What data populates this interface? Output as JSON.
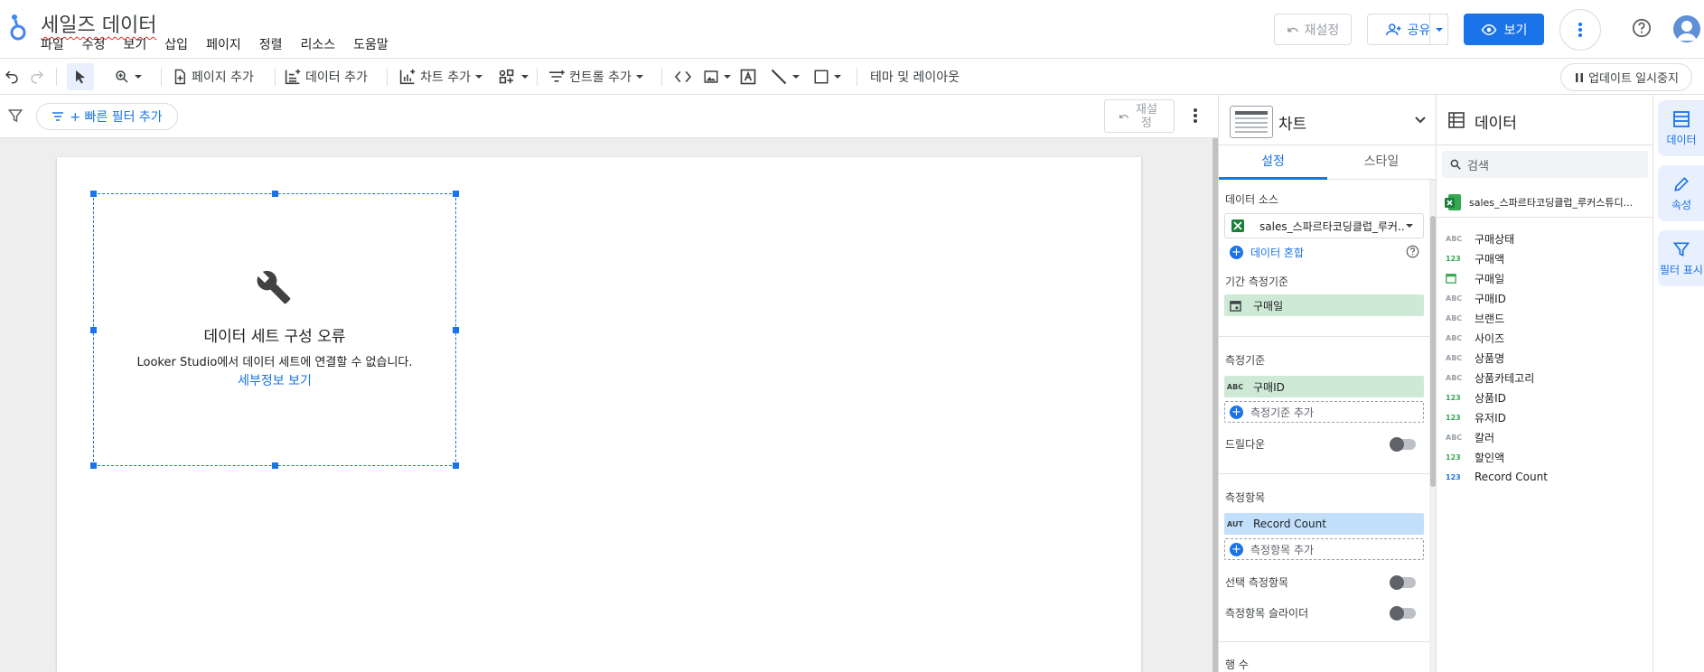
{
  "app": {
    "doc_title": "세일즈 데이터",
    "menu": [
      "파일",
      "수정",
      "보기",
      "삽입",
      "페이지",
      "정렬",
      "리소스",
      "도움말"
    ],
    "reset_label": "재설정",
    "share_label": "공유",
    "view_label": "보기"
  },
  "toolbar": {
    "add_page": "페이지 추가",
    "add_data": "데이터 추가",
    "add_chart": "차트 추가",
    "add_control": "컨트롤 추가",
    "theme_layout": "테마 및 레이아웃",
    "pause_updates": "업데이트 일시중지"
  },
  "filterbar": {
    "quick_filter": "+ 빠른 필터 추가",
    "reset_line1": "재설",
    "reset_line2": "정"
  },
  "chart_error": {
    "title": "데이터 세트 구성 오류",
    "message": "Looker Studio에서 데이터 세트에 연결할 수 없습니다.",
    "link": "세부정보 보기"
  },
  "props": {
    "chart_label": "차트",
    "tabs": [
      "설정",
      "스타일"
    ],
    "data_source_label": "데이터 소스",
    "data_source_value": "sales_스파르타코딩클럽_루커...",
    "blend_label": "데이터 혼합",
    "date_range_label": "기간 측정기준",
    "date_range_field": "구매일",
    "dimension_label": "측정기준",
    "dimension_field": "구매ID",
    "dimension_type": "ABC",
    "add_dimension": "측정기준 추가",
    "drilldown_label": "드릴다운",
    "metric_label": "측정항목",
    "metric_field": "Record Count",
    "metric_type": "AUT",
    "add_metric": "측정항목 추가",
    "optional_metrics": "선택 측정항목",
    "metric_slider": "측정항목 슬라이더",
    "rows_label": "행 수"
  },
  "data_panel": {
    "title": "데이터",
    "search_placeholder": "검색",
    "source_name": "sales_스파르타코딩클럽_루커스튜디...",
    "fields": [
      {
        "type": "ABC",
        "name": "구매상태"
      },
      {
        "type": "123",
        "name": "구매액"
      },
      {
        "type": "date",
        "name": "구매일"
      },
      {
        "type": "ABC",
        "name": "구매ID"
      },
      {
        "type": "ABC",
        "name": "브랜드"
      },
      {
        "type": "ABC",
        "name": "사이즈"
      },
      {
        "type": "ABC",
        "name": "상품명"
      },
      {
        "type": "ABC",
        "name": "상품카테고리"
      },
      {
        "type": "123",
        "name": "상품ID"
      },
      {
        "type": "123",
        "name": "유저ID"
      },
      {
        "type": "ABC",
        "name": "칼러"
      },
      {
        "type": "123",
        "name": "할인액"
      },
      {
        "type": "123",
        "name": "Record Count"
      }
    ]
  },
  "rail": {
    "data": "데이터",
    "props": "속성",
    "filter": "필터 표시"
  },
  "colors": {
    "accent": "#1a73e8",
    "dimension_chip": "#ceead6",
    "metric_chip": "#c2e0fc"
  }
}
